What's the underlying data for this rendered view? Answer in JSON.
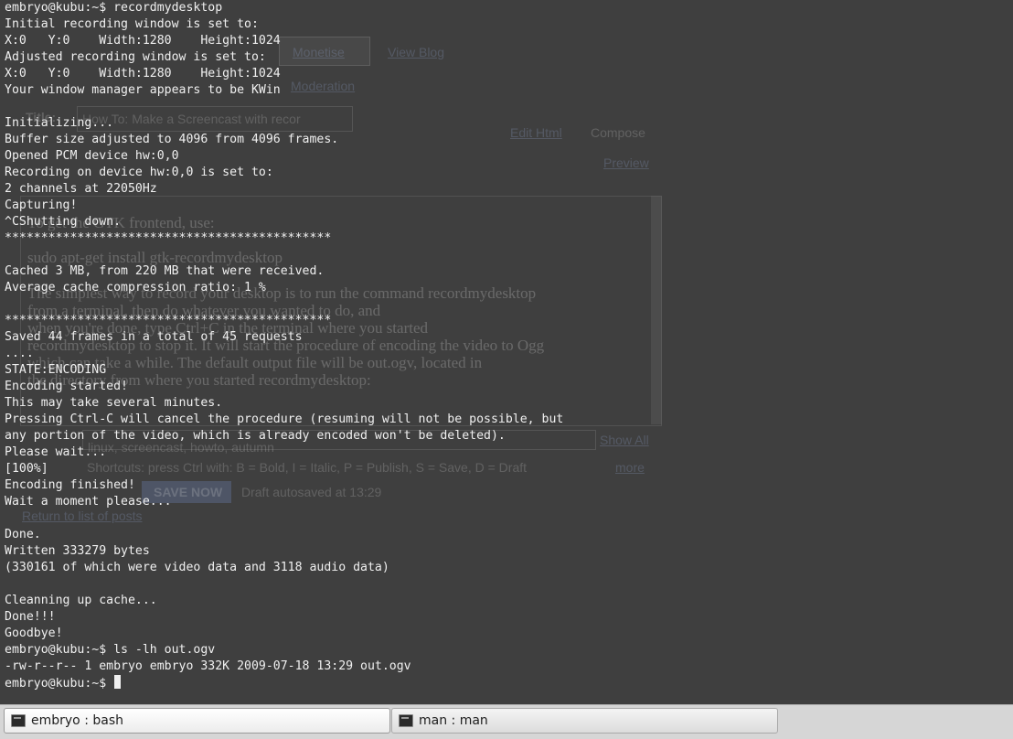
{
  "terminal": {
    "lines": [
      "embryo@kubu:~$ recordmydesktop",
      "Initial recording window is set to:",
      "X:0   Y:0    Width:1280    Height:1024",
      "Adjusted recording window is set to:",
      "X:0   Y:0    Width:1280    Height:1024",
      "Your window manager appears to be KWin",
      "",
      "Initializing...",
      "Buffer size adjusted to 4096 from 4096 frames.",
      "Opened PCM device hw:0,0",
      "Recording on device hw:0,0 is set to:",
      "2 channels at 22050Hz",
      "Capturing!",
      "^CShutting down.",
      "*********************************************",
      "",
      "Cached 3 MB, from 220 MB that were received.",
      "Average cache compression ratio: 1 %",
      "",
      "*********************************************",
      "Saved 44 frames in a total of 45 requests",
      "....",
      "STATE:ENCODING",
      "Encoding started!",
      "This may take several minutes.",
      "Pressing Ctrl-C will cancel the procedure (resuming will not be possible, but",
      "any portion of the video, which is already encoded won't be deleted).",
      "Please wait...",
      "[100%]",
      "Encoding finished!",
      "Wait a moment please...",
      "",
      "Done.",
      "Written 333279 bytes",
      "(330161 of which were video data and 3118 audio data)",
      "",
      "Cleanning up cache...",
      "Done!!!",
      "Goodbye!",
      "embryo@kubu:~$ ls -lh out.ogv",
      "-rw-r--r-- 1 embryo embryo 332K 2009-07-18 13:29 out.ogv",
      "embryo@kubu:~$ "
    ]
  },
  "background_page": {
    "tabs": [
      "Monetise",
      "View Blog"
    ],
    "moderation": "Moderation",
    "title_label": "Title:",
    "title_value": "How To: Make a Screencast with recor",
    "edit_html": "Edit Html",
    "compose": "Compose",
    "preview": "Preview",
    "body_lines": [
      "To get the GTK frontend, use:",
      "sudo apt-get install gtk-recordmydesktop",
      "The simplest way to record your desktop is to run the command recordmydesktop",
      "from a terminal, then do whatever you wanted to do, and",
      "when you're done, type Ctrl+C in the terminal where you started",
      "recordmydesktop to stop it. It will start the procedure of encoding the video to Ogg",
      "which can take a while. The default output file will be out.ogv, located in",
      "the directory from where you started recordmydesktop:"
    ],
    "labels_value": "linux, screencast, howto, autumn",
    "show_all": "Show All",
    "shortcuts": "Shortcuts: press Ctrl with: B = Bold, I = Italic, P = Publish, S = Save, D = Draft",
    "shortcuts_more": "more",
    "save_now": "SAVE NOW",
    "draft_status": "Draft autosaved at 13:29",
    "return_link": "Return to list of posts"
  },
  "taskbar": {
    "tasks": [
      {
        "label": "embryo : bash",
        "icon": "terminal-icon",
        "active": true
      },
      {
        "label": "man : man",
        "icon": "terminal-icon",
        "active": false
      }
    ]
  },
  "colors": {
    "terminal_bg": "#3f3f3f",
    "terminal_fg": "#f0f0f0",
    "taskbar_bg": "#d6d6d6"
  }
}
